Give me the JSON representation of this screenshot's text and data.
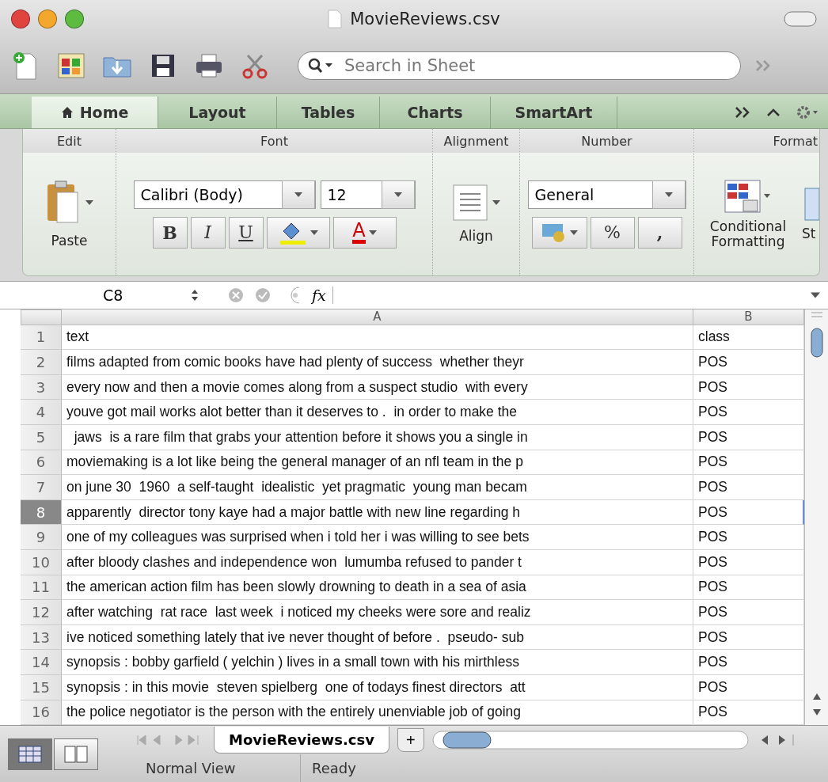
{
  "window": {
    "title": "MovieReviews.csv"
  },
  "toolbar": {
    "search": {
      "placeholder": "Search in Sheet"
    }
  },
  "tabs": [
    {
      "label": "Home",
      "selected": true
    },
    {
      "label": "Layout",
      "selected": false
    },
    {
      "label": "Tables",
      "selected": false
    },
    {
      "label": "Charts",
      "selected": false
    },
    {
      "label": "SmartArt",
      "selected": false
    }
  ],
  "ribbon": {
    "groups": [
      "Edit",
      "Font",
      "Alignment",
      "Number",
      "Format"
    ],
    "paste": "Paste",
    "font_name": "Calibri (Body)",
    "font_size": "12",
    "bold": "B",
    "italic": "I",
    "underline": "U",
    "font_color": "A",
    "align": "Align",
    "number_format": "General",
    "percent": "%",
    "comma": ",",
    "conditional": "Conditional Formatting",
    "styles": "St"
  },
  "formula_bar": {
    "cell": "C8",
    "fx": "fx"
  },
  "table": {
    "columns": [
      "A",
      "B"
    ],
    "rows": [
      {
        "n": "1",
        "a": "text",
        "b": "class",
        "selected": false
      },
      {
        "n": "2",
        "a": "films adapted from comic books have had plenty of success  whether theyr",
        "b": "POS",
        "selected": false
      },
      {
        "n": "3",
        "a": "every now and then a movie comes along from a suspect studio  with every",
        "b": "POS",
        "selected": false
      },
      {
        "n": "4",
        "a": "youve got mail works alot better than it deserves to .  in order to make the",
        "b": "POS",
        "selected": false
      },
      {
        "n": "5",
        "a": "  jaws  is a rare film that grabs your attention before it shows you a single in",
        "b": "POS",
        "selected": false
      },
      {
        "n": "6",
        "a": "moviemaking is a lot like being the general manager of an nfl team in the p",
        "b": "POS",
        "selected": false
      },
      {
        "n": "7",
        "a": "on june 30  1960  a self-taught  idealistic  yet pragmatic  young man becam",
        "b": "POS",
        "selected": false
      },
      {
        "n": "8",
        "a": "apparently  director tony kaye had a major battle with new line regarding h",
        "b": "POS",
        "selected": true
      },
      {
        "n": "9",
        "a": "one of my colleagues was surprised when i told her i was willing to see bets",
        "b": "POS",
        "selected": false
      },
      {
        "n": "10",
        "a": "after bloody clashes and independence won  lumumba refused to pander t",
        "b": "POS",
        "selected": false
      },
      {
        "n": "11",
        "a": "the american action film has been slowly drowning to death in a sea of asia",
        "b": "POS",
        "selected": false
      },
      {
        "n": "12",
        "a": "after watching  rat race  last week  i noticed my cheeks were sore and realiz",
        "b": "POS",
        "selected": false
      },
      {
        "n": "13",
        "a": "ive noticed something lately that ive never thought of before .  pseudo- sub",
        "b": "POS",
        "selected": false
      },
      {
        "n": "14",
        "a": "synopsis : bobby garfield ( yelchin ) lives in a small town with his mirthless",
        "b": "POS",
        "selected": false
      },
      {
        "n": "15",
        "a": "synopsis : in this movie  steven spielberg  one of todays finest directors  att",
        "b": "POS",
        "selected": false
      },
      {
        "n": "16",
        "a": "the police negotiator is the person with the entirely unenviable job of going",
        "b": "POS",
        "selected": false
      }
    ]
  },
  "sheet_tabs": [
    {
      "label": "MovieReviews.csv",
      "selected": true
    }
  ],
  "add_sheet": "+",
  "views": [
    {
      "kind": "normal",
      "selected": true
    },
    {
      "kind": "layout",
      "selected": false
    }
  ],
  "status_bar": {
    "view": "Normal View",
    "state": "Ready"
  }
}
